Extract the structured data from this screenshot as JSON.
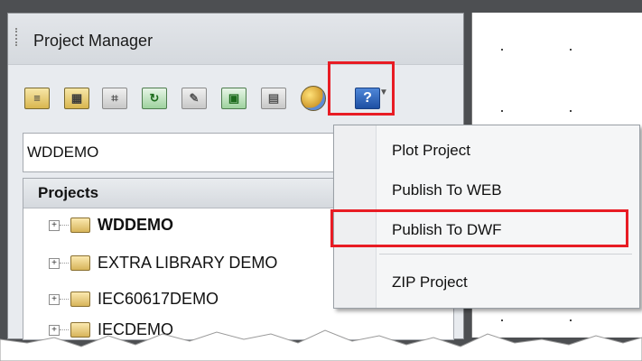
{
  "panel": {
    "title": "Project Manager"
  },
  "toolbar": {
    "buttons": [
      {
        "name": "open-project-icon"
      },
      {
        "name": "new-project-icon"
      },
      {
        "name": "new-drawing-icon"
      },
      {
        "name": "refresh-icon"
      },
      {
        "name": "project-task-list-icon"
      },
      {
        "name": "project-properties-icon"
      },
      {
        "name": "drawing-list-display-icon"
      },
      {
        "name": "publish-plot-icon"
      },
      {
        "name": "help-icon",
        "glyph": "?"
      }
    ]
  },
  "active_project": "WDDEMO",
  "projects": {
    "header": "Projects",
    "items": [
      {
        "label": "WDDEMO",
        "bold": true
      },
      {
        "label": "EXTRA LIBRARY DEMO",
        "bold": false
      },
      {
        "label": "IEC60617DEMO",
        "bold": false
      },
      {
        "label": "IECDEMO",
        "bold": false
      }
    ]
  },
  "menu": {
    "items": [
      {
        "label": "Plot Project"
      },
      {
        "label": "Publish To WEB"
      },
      {
        "label": "Publish To DWF"
      },
      {
        "label": "ZIP Project"
      }
    ]
  },
  "colors": {
    "highlight": "#e81c24",
    "frame": "#4d4f52"
  }
}
